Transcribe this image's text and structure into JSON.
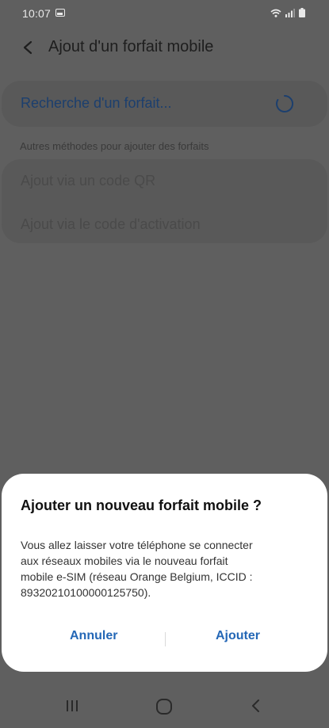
{
  "status_bar": {
    "time": "10:07",
    "icons": [
      "gallery-icon",
      "wifi-icon",
      "signal-icon",
      "battery-icon"
    ]
  },
  "header": {
    "title": "Ajout d'un forfait mobile",
    "back_icon": "back-arrow-icon"
  },
  "search": {
    "label": "Recherche d'un forfait...",
    "spinner_icon": "loading-spinner-icon"
  },
  "methods": {
    "section_label": "Autres méthodes pour ajouter des forfaits",
    "items": [
      {
        "label": "Ajout via un code QR"
      },
      {
        "label": "Ajout via le code d'activation"
      }
    ]
  },
  "dialog": {
    "title": "Ajouter un nouveau forfait mobile ?",
    "body_lines": [
      "Vous allez laisser votre téléphone se connecter",
      "aux réseaux mobiles via le nouveau forfait",
      "mobile e-SIM (réseau Orange Belgium, ICCID :",
      "8932021010000012575­0)."
    ],
    "cancel_label": "Annuler",
    "confirm_label": "Ajouter"
  },
  "navbar": {
    "icons": [
      "recents-icon",
      "home-icon",
      "back-icon"
    ]
  },
  "colors": {
    "overlay_background": "#5f5f5f",
    "link_blue": "#2467b6",
    "dialog_background": "#ffffff"
  }
}
